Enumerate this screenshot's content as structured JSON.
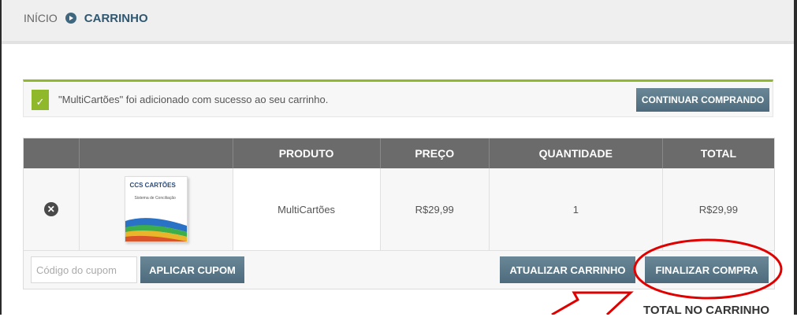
{
  "breadcrumb": {
    "home": "INÍCIO",
    "current": "CARRINHO"
  },
  "notice": {
    "message": "\"MultiCartões\" foi adicionado com sucesso ao seu carrinho.",
    "button": "CONTINUAR COMPRANDO"
  },
  "cart": {
    "columns": [
      "",
      "",
      "PRODUTO",
      "PREÇO",
      "QUANTIDADE",
      "TOTAL"
    ],
    "items": [
      {
        "product": "MultiCartões",
        "price": "R$29,99",
        "quantity": "1",
        "total": "R$29,99",
        "thumb_title": "CCS CARTÕES",
        "thumb_sub": "Sistema de Conciliação"
      }
    ],
    "remove_icon": "close-icon"
  },
  "actions": {
    "coupon_placeholder": "Código do cupom",
    "apply_coupon": "APLICAR CUPOM",
    "update_cart": "ATUALIZAR CARRINHO",
    "checkout": "FINALIZAR COMPRA"
  },
  "totals": {
    "heading": "TOTAL NO CARRINHO"
  },
  "colors": {
    "accent": "#4d6b7c",
    "success": "#8fb82a",
    "annotation": "#e00000",
    "header": "#6b6b6b"
  }
}
